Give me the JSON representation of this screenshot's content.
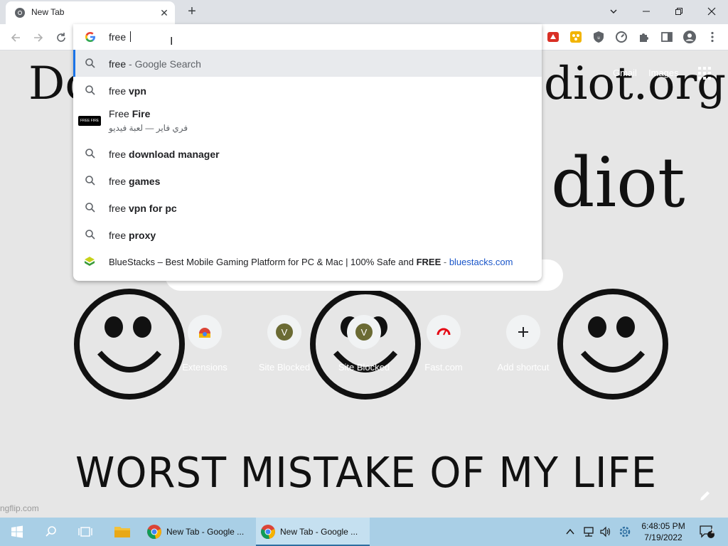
{
  "browser": {
    "tab": {
      "title": "New Tab"
    },
    "omnibox_text": "free ",
    "suggestions": [
      {
        "prefix": "free",
        "bold": "",
        "suffix": " - Google Search",
        "type": "search"
      },
      {
        "prefix": "free ",
        "bold": "vpn",
        "suffix": "",
        "type": "search"
      },
      {
        "prefix": "Free ",
        "bold": "Fire",
        "subtitle": "فري فاير — لعبة فيديو",
        "type": "entity"
      },
      {
        "prefix": "free ",
        "bold": "download manager",
        "suffix": "",
        "type": "search"
      },
      {
        "prefix": "free ",
        "bold": "games",
        "suffix": "",
        "type": "search"
      },
      {
        "prefix": "free ",
        "bold": "vpn for pc",
        "suffix": "",
        "type": "search"
      },
      {
        "prefix": "free ",
        "bold": "proxy",
        "suffix": "",
        "type": "search"
      },
      {
        "text_before": "BlueStacks – Best Mobile Gaming Platform for PC & Mac | 100% Safe and ",
        "bold": "FREE",
        "separator": " - ",
        "url": "bluestacks.com",
        "type": "site"
      }
    ]
  },
  "newtab": {
    "bg_title_left": "Do",
    "bg_title_right": "diot.org",
    "bg_idiot": "diot",
    "bg_worst": "WORST MISTAKE OF MY LIFE",
    "watermark": "ngflip.com",
    "top_links": {
      "gmail": "Gmail",
      "images": "Images"
    },
    "shortcuts": [
      {
        "label": "Extensions",
        "icon": "chrome-web-store-icon"
      },
      {
        "label": "Site Blocked",
        "icon": "site-blocked-v-icon"
      },
      {
        "label": "Site Blocked",
        "icon": "site-blocked-v-icon"
      },
      {
        "label": "Fast.com",
        "icon": "fast-com-icon"
      },
      {
        "label": "Add shortcut",
        "icon": "plus-icon"
      }
    ]
  },
  "taskbar": {
    "apps": [
      {
        "label": "New Tab - Google ..."
      },
      {
        "label": "New Tab - Google ..."
      }
    ],
    "clock_time": "6:48:05 PM",
    "clock_date": "7/19/2022",
    "notification_count": "1"
  },
  "colors": {
    "accent": "#1a73e8",
    "taskbar": "#a9cfe6",
    "url_link": "#1a56c9"
  }
}
